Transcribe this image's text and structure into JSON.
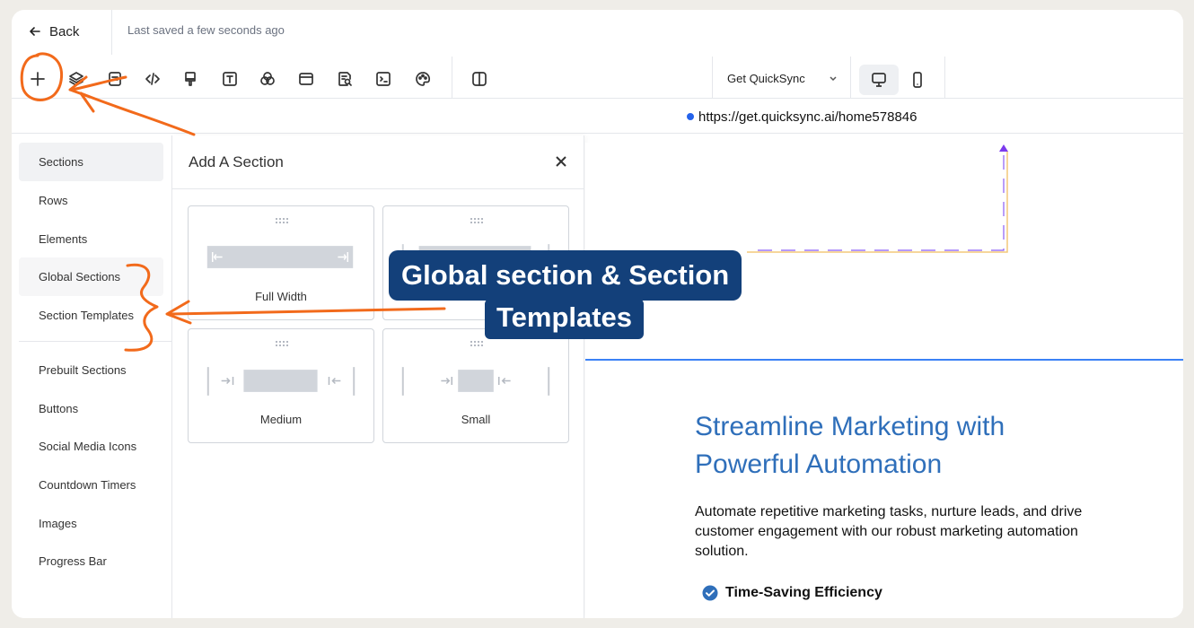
{
  "topbar": {
    "back_label": "Back",
    "saved_text": "Last saved a few seconds ago"
  },
  "toolbar": {
    "tools": [
      "add-icon",
      "layers-icon",
      "page-icon",
      "code-icon",
      "paint-icon",
      "text-icon",
      "color-icon",
      "browser-icon",
      "search-doc-icon",
      "terminal-icon",
      "palette-icon",
      "split-view-icon"
    ],
    "site_select": "Get QuickSync",
    "devices": [
      "desktop-icon",
      "mobile-icon"
    ]
  },
  "urlbar": {
    "url": "https://get.quicksync.ai/home578846",
    "dot_color": "#2563eb"
  },
  "leftnav": {
    "items": [
      "Sections",
      "Rows",
      "Elements",
      "Global Sections",
      "Section Templates",
      "Prebuilt Sections",
      "Buttons",
      "Social Media Icons",
      "Countdown Timers",
      "Images",
      "Progress Bar"
    ],
    "active": "Sections"
  },
  "panel": {
    "title": "Add A Section",
    "cards": [
      "Full Width",
      "",
      "Medium",
      "Small"
    ]
  },
  "canvas": {
    "hero_title": "Streamline Marketing with Powerful Automation",
    "hero_desc": "Automate repetitive marketing tasks, nurture leads, and drive customer engagement with our robust marketing automation solution.",
    "feature": "Time-Saving Efficiency",
    "title_color": "#2f6fba"
  },
  "annotation": {
    "line1": "Global section & Section",
    "line2": "Templates",
    "callout_color": "#13407a",
    "pen_color": "#f26a1b"
  }
}
